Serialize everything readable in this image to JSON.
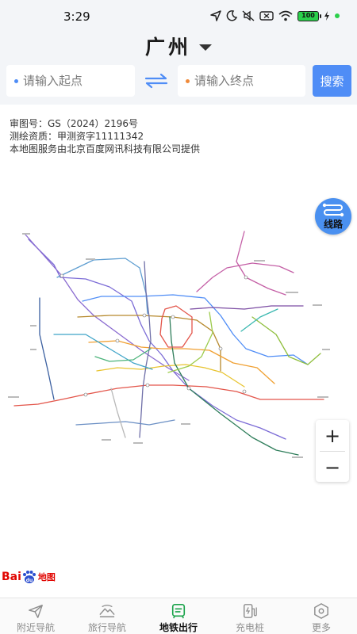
{
  "status_bar": {
    "time": "3:29",
    "battery": "100",
    "icons": [
      "location-arrow-icon",
      "moon-icon",
      "mute-icon",
      "sim-x-icon",
      "wifi-icon",
      "battery-icon",
      "charging-icon"
    ]
  },
  "header": {
    "city": "广州",
    "start_placeholder": "请输入起点",
    "end_placeholder": "请输入终点",
    "search_label": "搜索",
    "start_dot_color": "#4f8df6",
    "end_dot_color": "#f08a3a"
  },
  "map": {
    "approval_line1": "审图号：GS（2024）2196号",
    "approval_line2": "测绘资质：甲测资字11111342",
    "approval_line3": "本地图服务由北京百度网讯科技有限公司提供",
    "route_button_label": "线路",
    "zoom_in": "+",
    "zoom_out": "−",
    "logo_text": "Bai",
    "logo_text2": "du",
    "logo_sub": "地图"
  },
  "tabbar": {
    "tabs": [
      {
        "label": "附近导航",
        "icon": "send-icon",
        "active": false
      },
      {
        "label": "旅行导航",
        "icon": "mountain-icon",
        "active": false
      },
      {
        "label": "地铁出行",
        "icon": "metro-icon",
        "active": true
      },
      {
        "label": "充电桩",
        "icon": "charging-pile-icon",
        "active": false
      },
      {
        "label": "更多",
        "icon": "more-hexagon-icon",
        "active": false
      }
    ]
  },
  "colors": {
    "accent": "#4f8df6",
    "active_tab": "#1aa34a",
    "header_bg": "#f3f5f8"
  }
}
